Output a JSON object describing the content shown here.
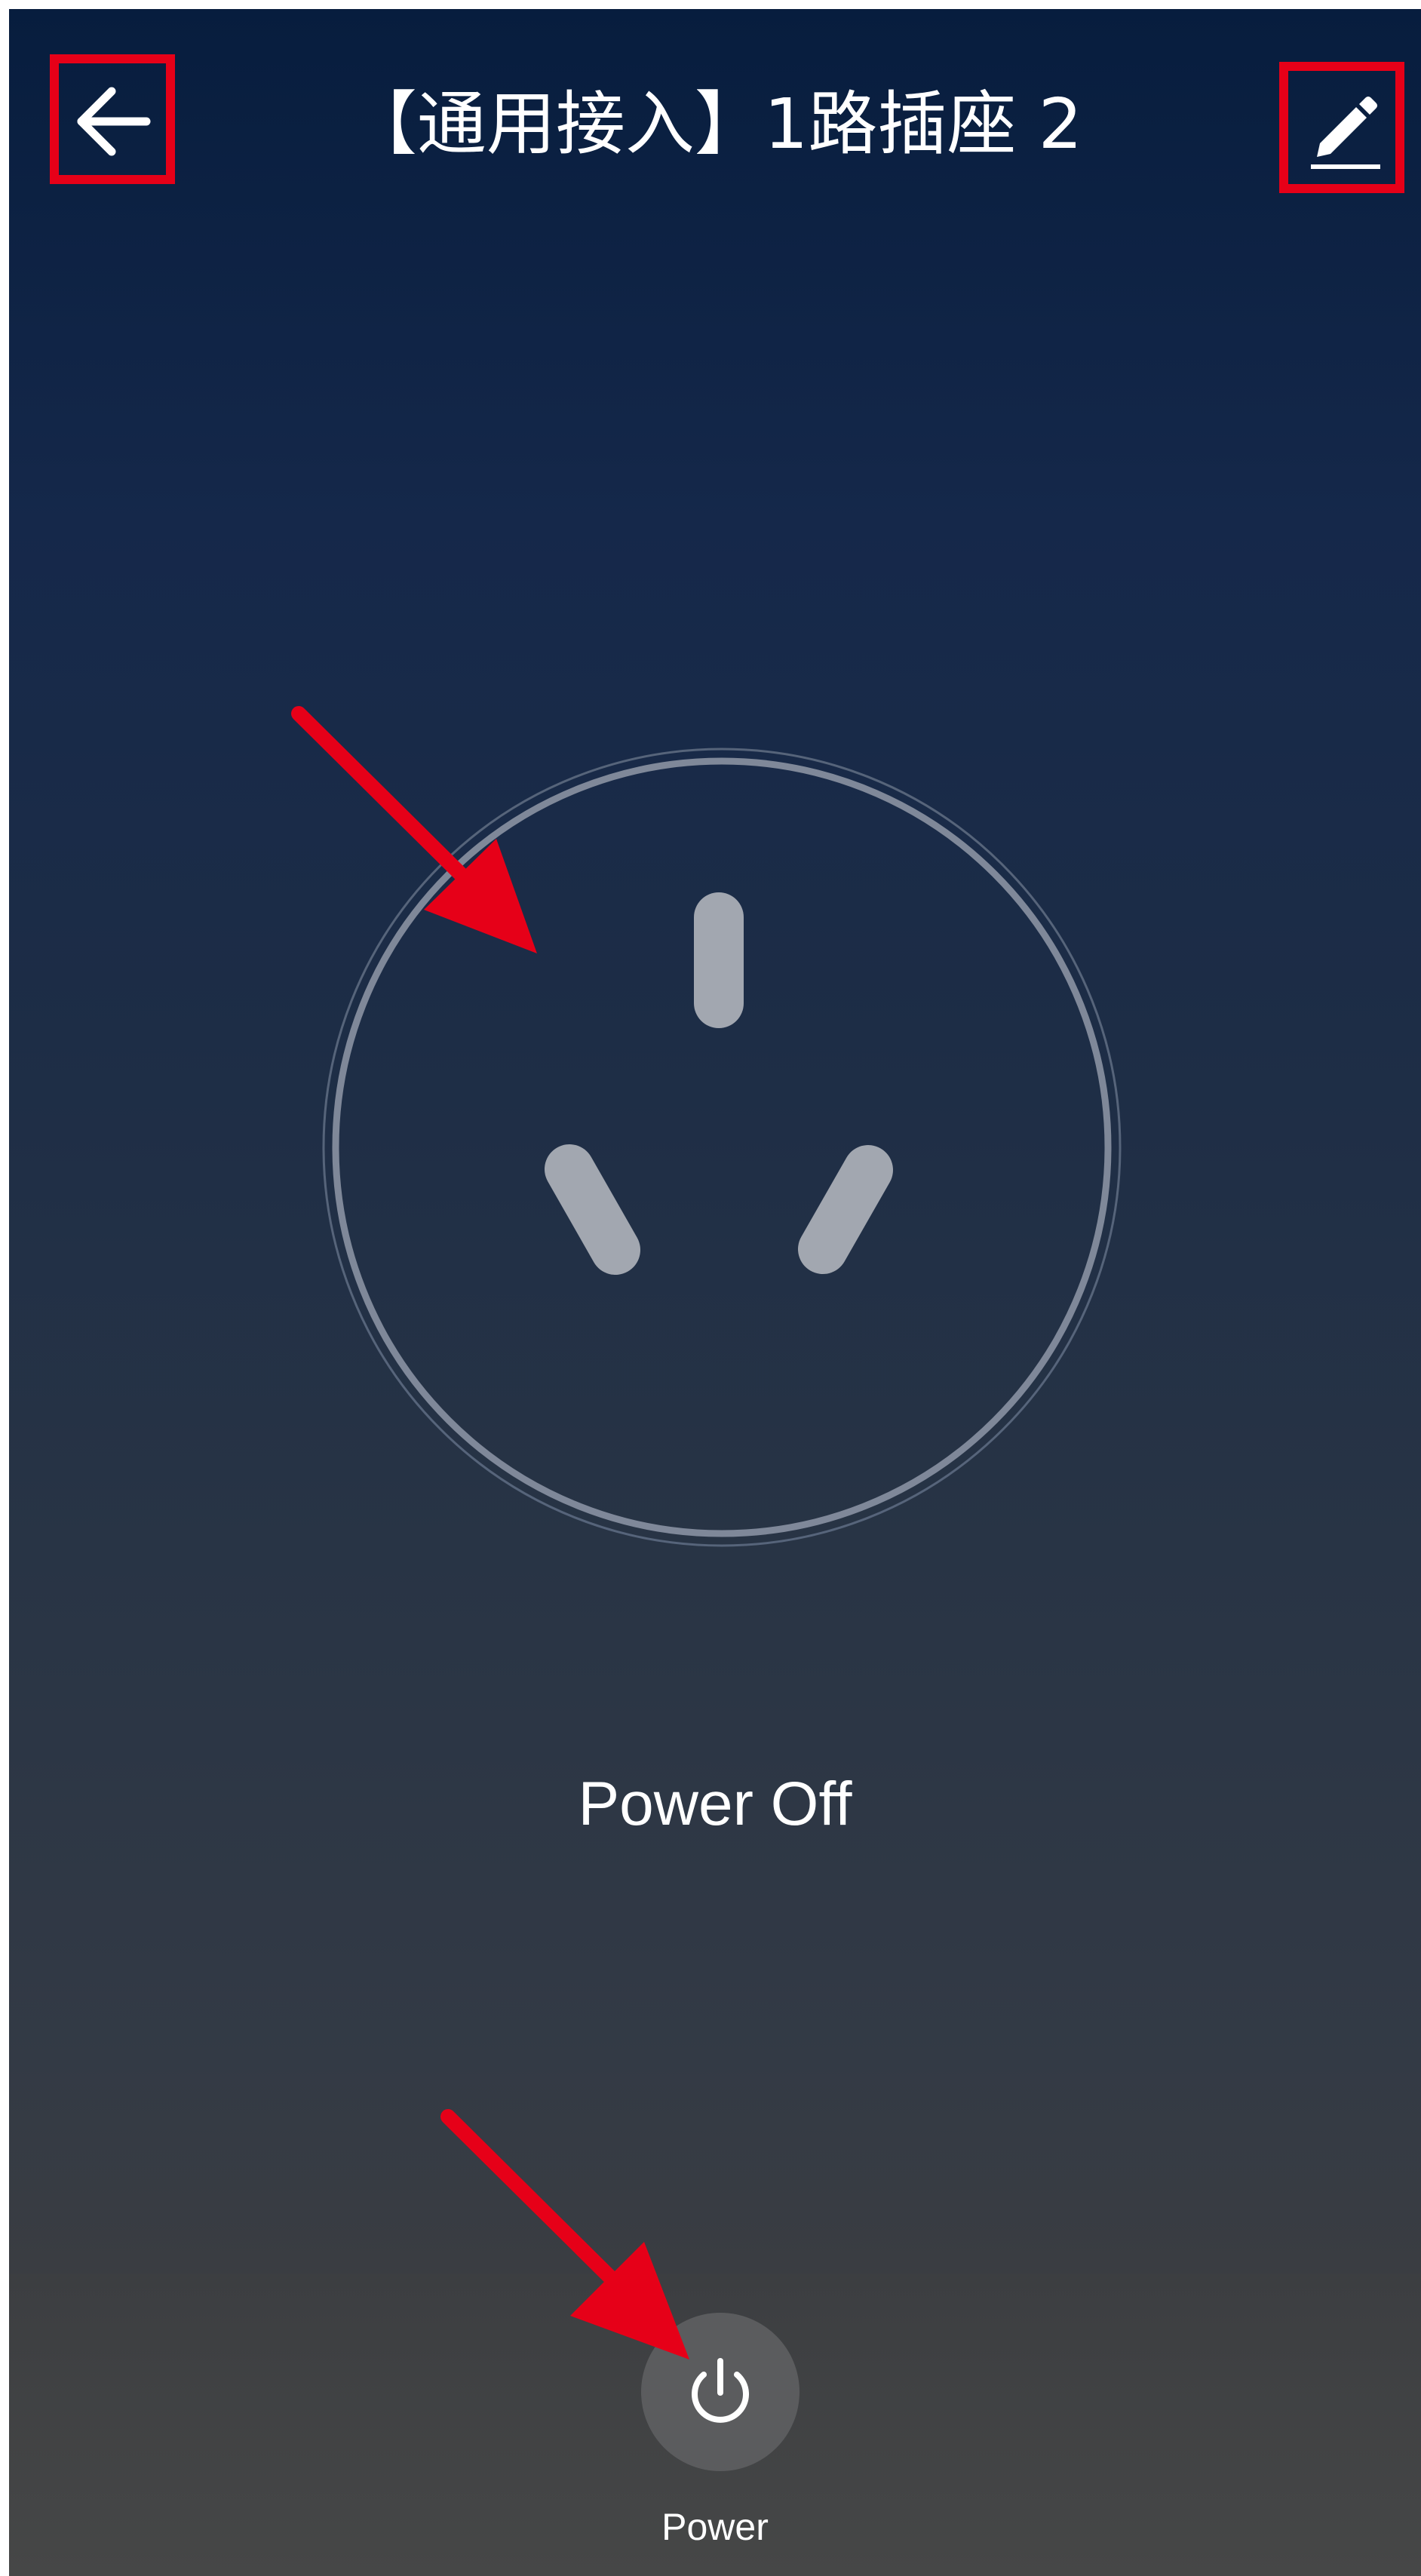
{
  "header": {
    "title": "【通用接入】1路插座 2",
    "back_icon": "arrow-left-icon",
    "edit_icon": "pencil-icon"
  },
  "device": {
    "graphic_icon": "socket-outlet-icon",
    "status": "Power Off"
  },
  "controls": {
    "power_label": "Power",
    "power_icon": "power-icon"
  },
  "colors": {
    "annotation_red": "#e60018",
    "background_top": "#071d3e",
    "background_bottom": "#444648",
    "power_button_bg": "#5b5c5e",
    "socket_grey": "#a2a7b0"
  }
}
